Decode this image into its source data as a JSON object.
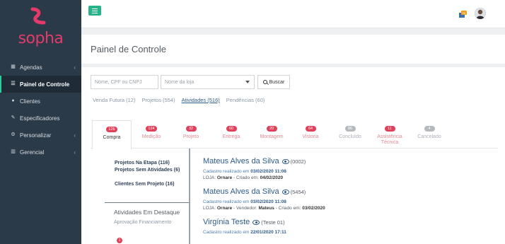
{
  "brand": {
    "name": "sopha",
    "color": "#e23b6a"
  },
  "sidebar": {
    "items": [
      {
        "label": "Agendas",
        "icon": "calendar-icon",
        "chevron": "‹"
      },
      {
        "label": "Painel de Controle",
        "icon": "list-icon",
        "active": true
      },
      {
        "label": "Clientes",
        "icon": "user-icon"
      },
      {
        "label": "Especificadores",
        "icon": "pencil-icon"
      },
      {
        "label": "Personalizar",
        "icon": "cogs-icon",
        "chevron": "‹"
      },
      {
        "label": "Gerencial",
        "icon": "chart-icon",
        "chevron": "‹"
      }
    ]
  },
  "topbar": {
    "notifications_count": "12"
  },
  "page": {
    "title": "Painel de Controle"
  },
  "search": {
    "cpf_placeholder": "Nome, CPF ou CNPJ",
    "store_placeholder": "Nome da loja",
    "button_label": "Buscar"
  },
  "filter_tabs": [
    {
      "label": "Venda Futura (12)"
    },
    {
      "label": "Projetos (554)"
    },
    {
      "label": "Atividades (516)",
      "active": true
    },
    {
      "label": "Pendências (60)"
    }
  ],
  "stages": [
    {
      "count": "126",
      "label": "Compra",
      "active": true
    },
    {
      "count": "124",
      "label": "Medição"
    },
    {
      "count": "32",
      "label": "Projeto"
    },
    {
      "count": "60",
      "label": "Entrega"
    },
    {
      "count": "20",
      "label": "Montagem"
    },
    {
      "count": "64",
      "label": "Vistoria"
    },
    {
      "count": "86",
      "label": "Concluído",
      "grey": true
    },
    {
      "count": "11",
      "label": "Assistência Técnica"
    },
    {
      "count": "4",
      "label": "Cancelado",
      "grey": true
    }
  ],
  "side_links": [
    {
      "label": "Projetos Na Etapa (116)"
    },
    {
      "label": "Projetos Sem Atividades (6)"
    },
    {
      "label": "Clientes Sem Projeto (16)"
    }
  ],
  "highlights": {
    "title": "Atividades Em Destaque",
    "item": "Aprovação Financiamento",
    "badge": "1"
  },
  "results": [
    {
      "name": "Mateus Alves da Silva",
      "code": "(0002)",
      "registered_label": "Cadastro realizado em",
      "registered_at": "03/02/2020 11:08",
      "store_label": "LOJA:",
      "store": "Ornare",
      "extra": "- Criado em:",
      "created": "04/02/2020"
    },
    {
      "name": "Mateus Alves da Silva",
      "code": "(5454)",
      "registered_label": "Cadastro realizado em",
      "registered_at": "03/02/2020 11:08",
      "store_label": "LOJA:",
      "store": "Ornare",
      "seller_label": "- Vendedor:",
      "seller": "Mateus",
      "extra": "- Criado em:",
      "created": "03/02/2020"
    },
    {
      "name": "Virgínia Teste",
      "code": "(Teste 01)",
      "registered_label": "Cadastro realizado em",
      "registered_at": "22/01/2020 17:11"
    }
  ]
}
